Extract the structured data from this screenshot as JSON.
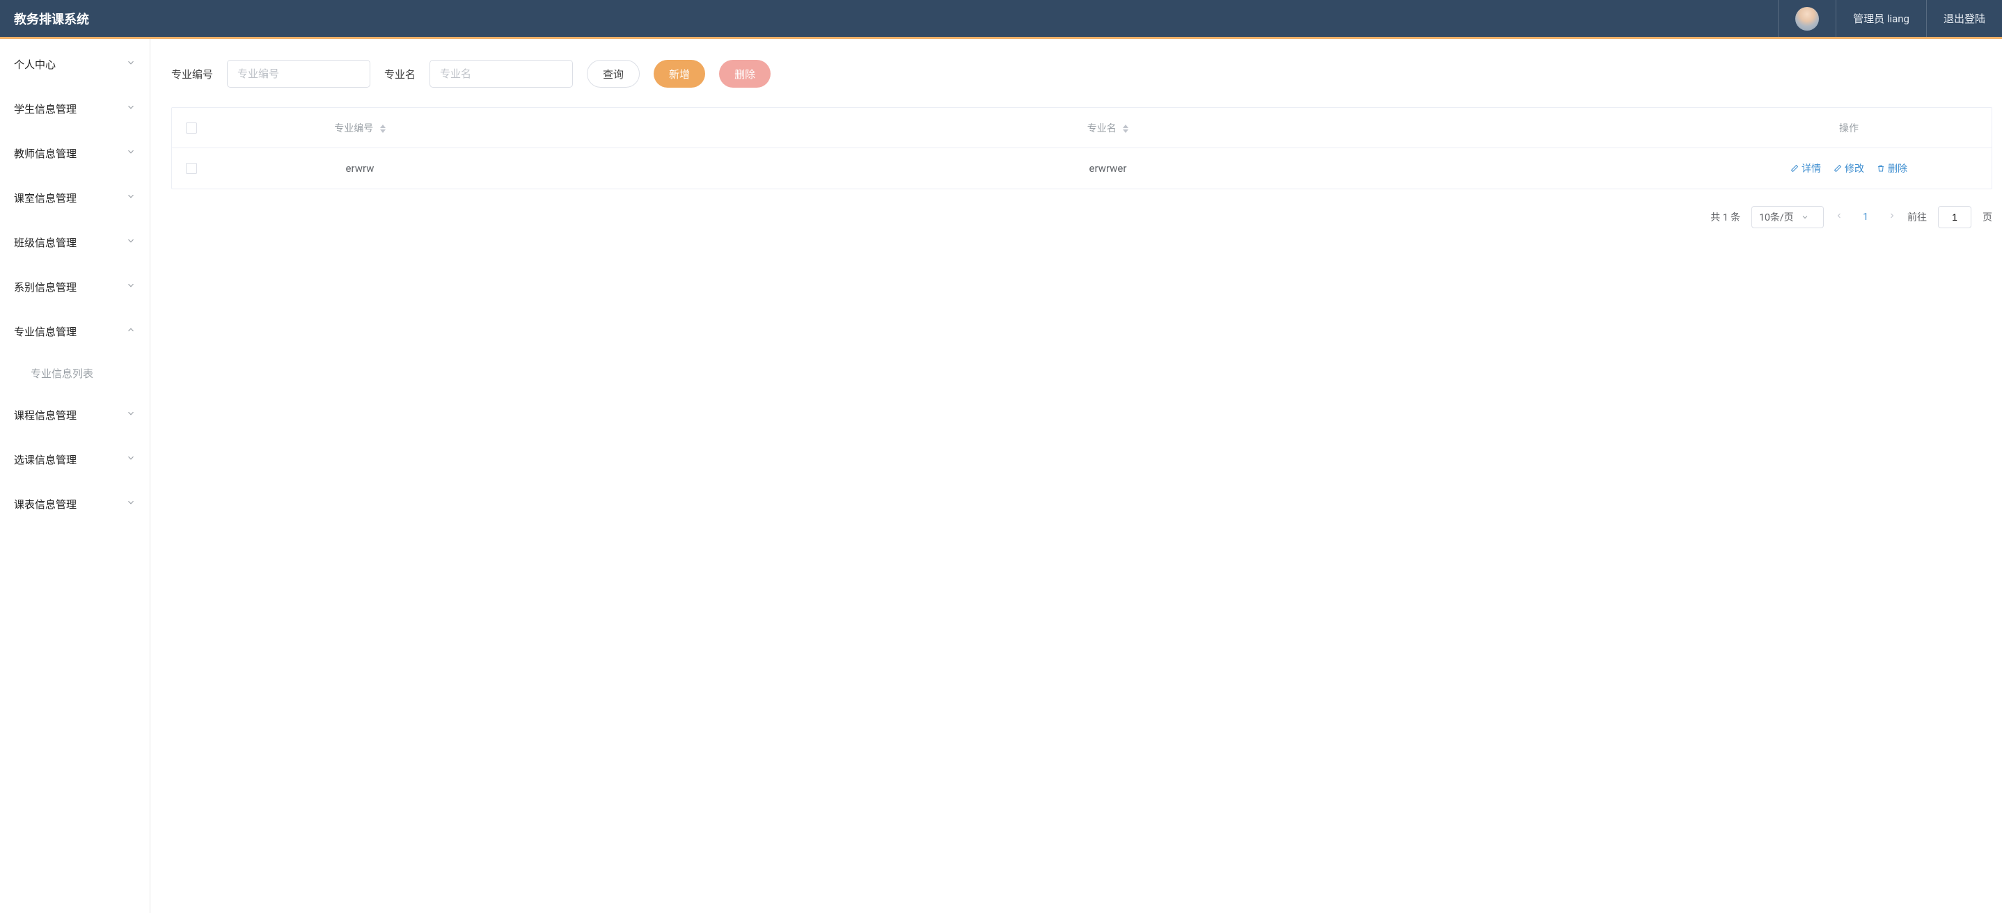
{
  "header": {
    "title": "教务排课系统",
    "user_label": "管理员 liang",
    "logout": "退出登陆"
  },
  "sidebar": {
    "items": [
      {
        "label": "个人中心",
        "expanded": false
      },
      {
        "label": "学生信息管理",
        "expanded": false
      },
      {
        "label": "教师信息管理",
        "expanded": false
      },
      {
        "label": "课室信息管理",
        "expanded": false
      },
      {
        "label": "班级信息管理",
        "expanded": false
      },
      {
        "label": "系别信息管理",
        "expanded": false
      },
      {
        "label": "专业信息管理",
        "expanded": true,
        "children": [
          {
            "label": "专业信息列表"
          }
        ]
      },
      {
        "label": "课程信息管理",
        "expanded": false
      },
      {
        "label": "选课信息管理",
        "expanded": false
      },
      {
        "label": "课表信息管理",
        "expanded": false
      }
    ]
  },
  "filters": {
    "label1": "专业编号",
    "placeholder1": "专业编号",
    "label2": "专业名",
    "placeholder2": "专业名",
    "search_btn": "查询",
    "add_btn": "新增",
    "delete_btn": "删除"
  },
  "table": {
    "columns": {
      "code": "专业编号",
      "name": "专业名",
      "ops": "操作"
    },
    "rows": [
      {
        "code": "erwrw",
        "name": "erwrwer"
      }
    ],
    "actions": {
      "detail": "详情",
      "edit": "修改",
      "delete": "删除"
    }
  },
  "pagination": {
    "total_prefix": "共",
    "total_count": "1",
    "total_suffix": "条",
    "page_size": "10条/页",
    "current": "1",
    "goto_prefix": "前往",
    "goto_value": "1",
    "goto_suffix": "页"
  }
}
